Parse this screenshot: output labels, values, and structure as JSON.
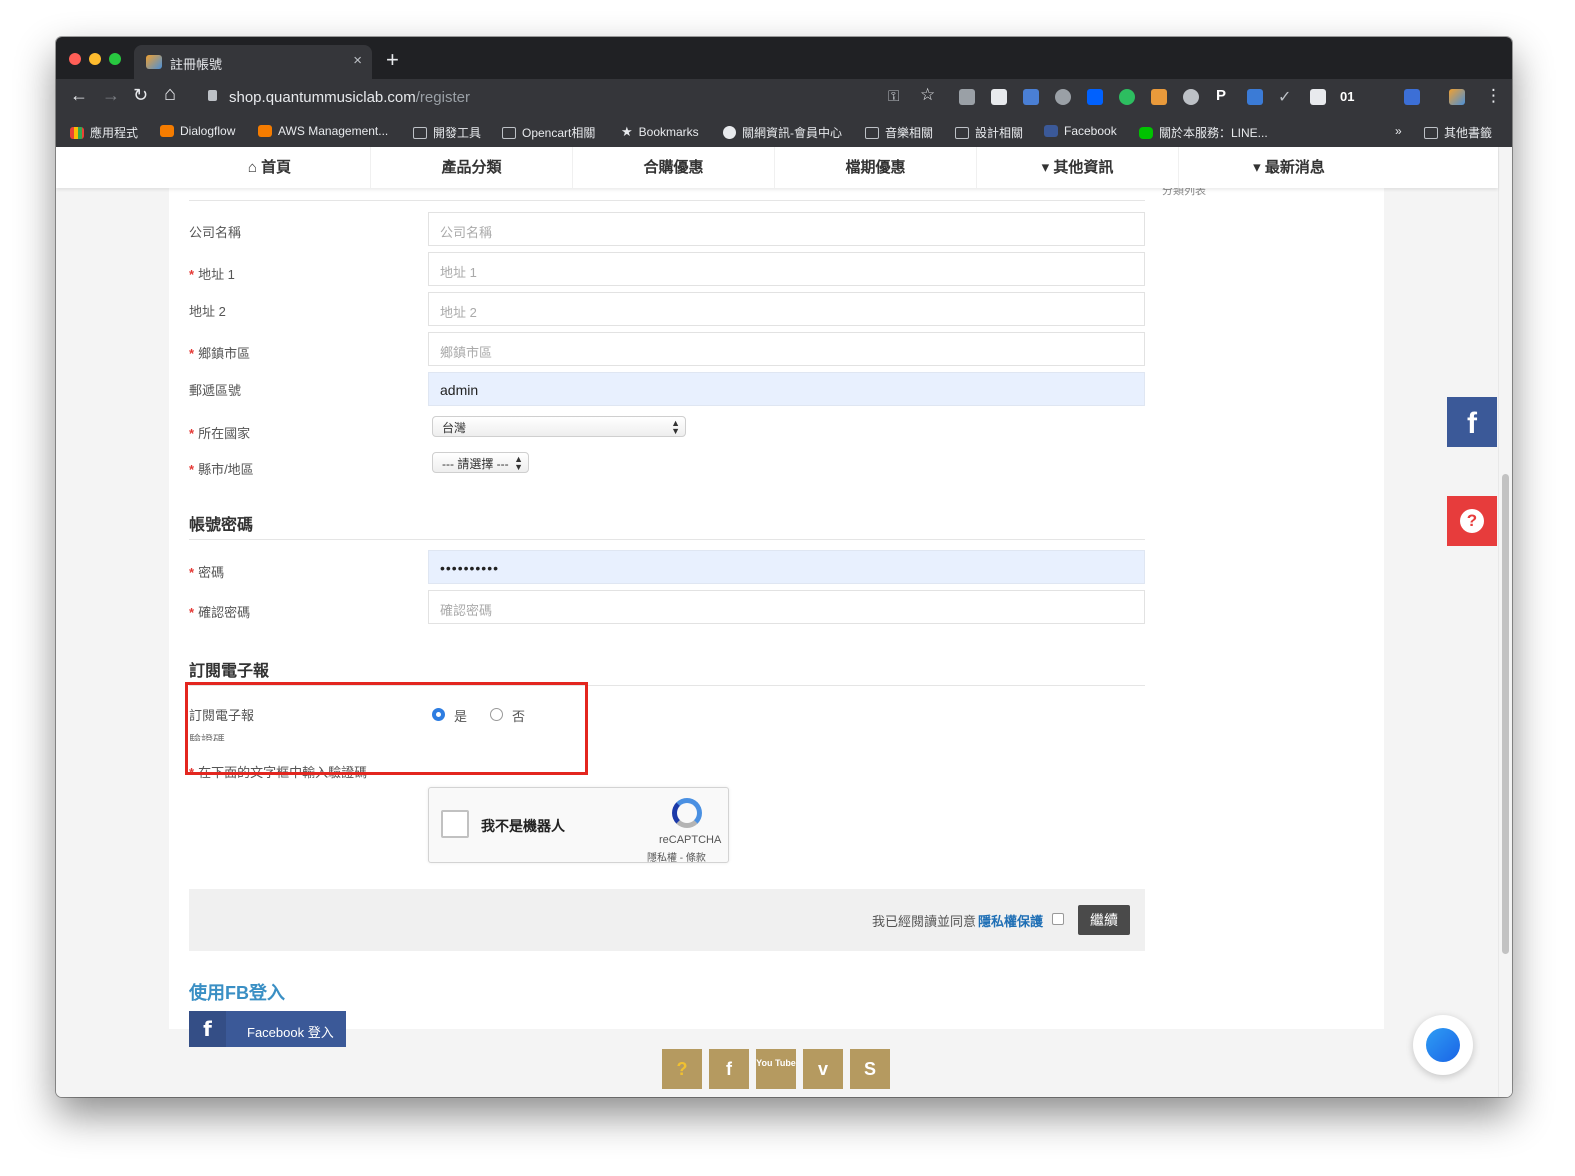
{
  "browser": {
    "tab_title": "註冊帳號",
    "tab_close": "×",
    "new_tab": "+",
    "url_host": "shop.quantummusiclab.com",
    "url_path": "/register",
    "nav": {
      "back": "←",
      "forward": "→",
      "reload": "↻",
      "home": "⌂"
    },
    "toolbar_icons": {
      "key": "⚿",
      "star": "☆",
      "p": "P",
      "check": "✓",
      "zero_one": "01",
      "menu": "⋮"
    },
    "bookmarks": [
      "應用程式",
      "Dialogflow",
      "AWS Management...",
      "開發工具",
      "Opencart相關",
      "Bookmarks",
      "關網資訊-會員中心",
      "音樂相關",
      "設計相關",
      "Facebook",
      "關於本服務：LINE..."
    ],
    "bookmarks_overflow": "»",
    "other_bookmarks": "其他書籤"
  },
  "topnav": {
    "items": [
      "首頁",
      "產品分類",
      "合購優惠",
      "檔期優惠",
      "其他資訊",
      "最新消息"
    ],
    "home_icon": "⌂",
    "caret": "▾"
  },
  "sidebar_cut_text": "分類列表",
  "address": {
    "company_label": "公司名稱",
    "company_placeholder": "公司名稱",
    "address1_label": "地址 1",
    "address1_placeholder": "地址 1",
    "address2_label": "地址 2",
    "address2_placeholder": "地址 2",
    "city_label": "鄉鎮市區",
    "city_placeholder": "鄉鎮市區",
    "postcode_label": "郵遞區號",
    "postcode_value": "admin",
    "country_label": "所在國家",
    "country_value": "台灣",
    "zone_label": "縣市/地區",
    "zone_value": "--- 請選擇 ---",
    "required_mark": "*"
  },
  "password_section": {
    "title": "帳號密碼",
    "password_label": "密碼",
    "password_value": "••••••••••",
    "confirm_label": "確認密碼",
    "confirm_placeholder": "確認密碼"
  },
  "newsletter": {
    "title": "訂閱電子報",
    "label": "訂閱電子報",
    "yes": "是",
    "no": "否",
    "selected": "是"
  },
  "captcha": {
    "section_cut": "驗證碼",
    "label": "在下面的文字框中輸入驗證碼",
    "checkbox_text": "我不是機器人",
    "brand": "reCAPTCHA",
    "terms": "隱私權 - 條款"
  },
  "agree": {
    "text": "我已經閱讀並同意",
    "link": "隱私權保護",
    "continue": "繼續"
  },
  "fb_login": {
    "title": "使用FB登入",
    "button": "Facebook 登入",
    "icon": "f"
  },
  "footer_social": [
    "?",
    "f",
    "You Tube",
    "v",
    "S"
  ],
  "side_buttons": {
    "facebook": "f",
    "help": "?"
  },
  "colors": {
    "accent_blue": "#3a8fc4",
    "facebook": "#3b5998",
    "highlight_red": "#e3261f",
    "required_red": "#e53935",
    "social_gold": "#b59a60",
    "help_red": "#e73c3c"
  }
}
